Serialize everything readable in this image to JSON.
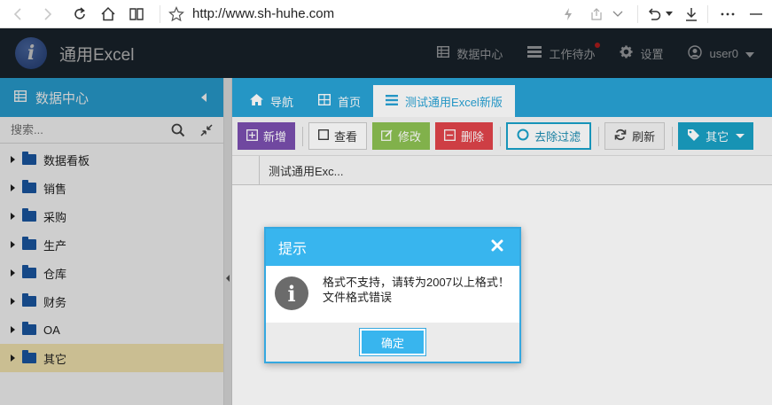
{
  "browser": {
    "url": "http://www.sh-huhe.com"
  },
  "header": {
    "logo_letter": "i",
    "app_title": "通用Excel",
    "items": [
      {
        "label": "数据中心",
        "icon": "grid-icon"
      },
      {
        "label": "工作待办",
        "icon": "tasks-icon"
      },
      {
        "label": "设置",
        "icon": "gear-icon"
      },
      {
        "label": "user0",
        "icon": "user-icon"
      }
    ]
  },
  "sidebar": {
    "title": "数据中心",
    "search_placeholder": "搜索...",
    "items": [
      {
        "label": "数据看板"
      },
      {
        "label": "销售"
      },
      {
        "label": "采购"
      },
      {
        "label": "生产"
      },
      {
        "label": "仓库"
      },
      {
        "label": "财务"
      },
      {
        "label": "OA"
      },
      {
        "label": "其它",
        "selected": true
      }
    ]
  },
  "tabs": [
    {
      "label": "导航",
      "icon": "home-icon"
    },
    {
      "label": "首页",
      "icon": "grid-icon"
    },
    {
      "label": "测试通用Excel新版",
      "icon": "list-icon",
      "active": true
    }
  ],
  "toolbar": {
    "add": "新增",
    "view": "查看",
    "edit": "修改",
    "delete": "删除",
    "clear_filter": "去除过滤",
    "refresh": "刷新",
    "other": "其它"
  },
  "grid": {
    "column_header": "测试通用Exc..."
  },
  "dialog": {
    "title": "提示",
    "message_line1": "格式不支持，请转为2007以上格式！",
    "message_line2": "文件格式错误",
    "ok_label": "确定"
  },
  "colors": {
    "header_bg": "#1f2b36",
    "accent_blue": "#29a3d6",
    "dialog_blue": "#38b5ee",
    "selected_row": "#fbecb6"
  }
}
